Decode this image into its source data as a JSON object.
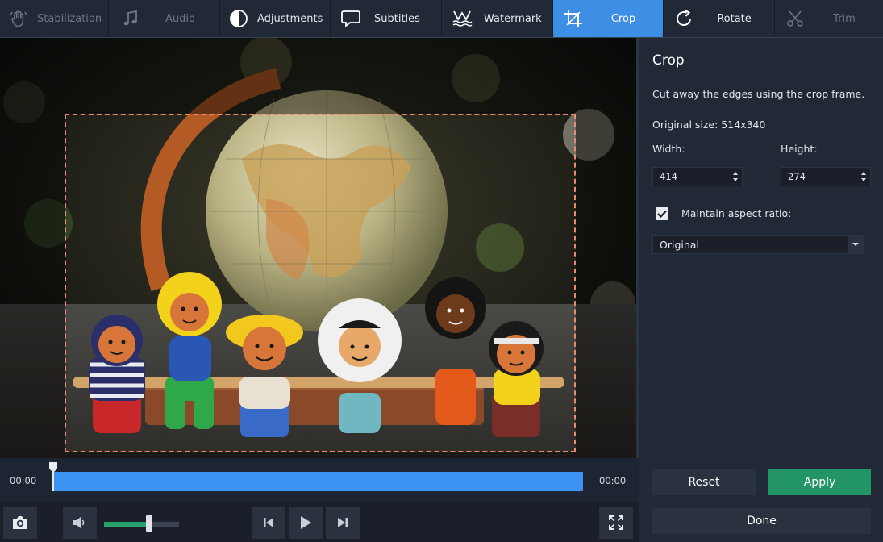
{
  "toolbar": {
    "tools": [
      {
        "label": "Stabilization",
        "icon": "hand-icon",
        "state": "disabled"
      },
      {
        "label": "Audio",
        "icon": "music-note-icon",
        "state": "disabled"
      },
      {
        "label": "Adjustments",
        "icon": "contrast-icon",
        "state": "normal"
      },
      {
        "label": "Subtitles",
        "icon": "speech-bubble-icon",
        "state": "normal"
      },
      {
        "label": "Watermark",
        "icon": "watermark-icon",
        "state": "normal"
      },
      {
        "label": "Crop",
        "icon": "crop-icon",
        "state": "active"
      },
      {
        "label": "Rotate",
        "icon": "rotate-icon",
        "state": "normal"
      },
      {
        "label": "Trim",
        "icon": "scissors-icon",
        "state": "disabled"
      }
    ]
  },
  "preview": {
    "image": "globe-with-toy-figures"
  },
  "panel": {
    "title": "Crop",
    "description": "Cut away the edges using the crop frame.",
    "original_size": "Original size: 514x340",
    "width_label": "Width:",
    "height_label": "Height:",
    "width_value": "414",
    "height_value": "274",
    "maintain_aspect_label": "Maintain aspect ratio:",
    "maintain_aspect_checked": true,
    "aspect_option": "Original",
    "reset_label": "Reset",
    "apply_label": "Apply",
    "done_label": "Done"
  },
  "timeline": {
    "start_time": "00:00",
    "end_time": "00:00"
  },
  "controls": {
    "volume_level": 0.6
  },
  "colors": {
    "accent": "#3d8fe6",
    "apply": "#239565",
    "crop_frame": "#f08a6e",
    "track": "#3d93f2"
  }
}
